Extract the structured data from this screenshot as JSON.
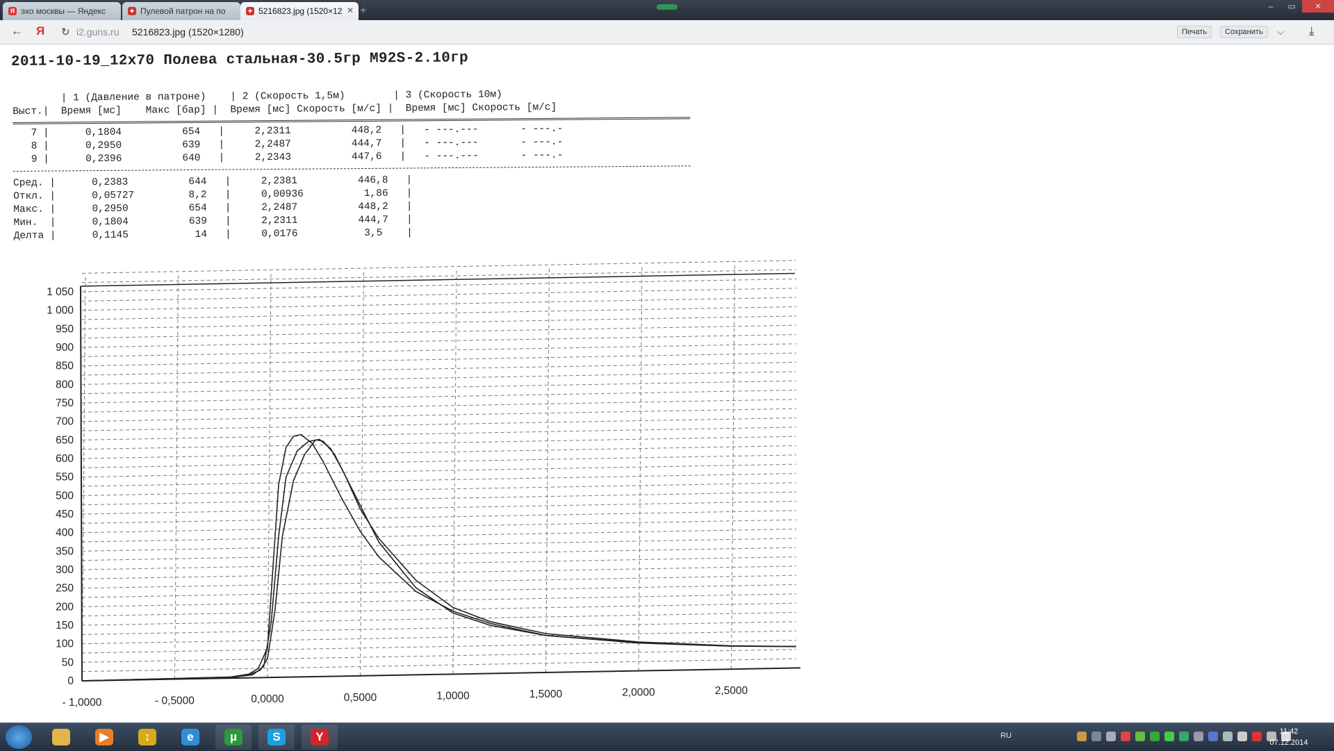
{
  "tabs": [
    {
      "label": "эхо москвы — Яндекс",
      "icon_color": "#d33"
    },
    {
      "label": "Пулевой патрон на по",
      "icon_color": "#c33"
    },
    {
      "label": "5216823.jpg (1520×12",
      "icon_color": "#c33"
    }
  ],
  "window": {
    "minimize": "–",
    "maximize": "▭",
    "close": "✕"
  },
  "address": {
    "host": "i2.guns.ru",
    "title": "5216823.jpg (1520×1280)"
  },
  "toolbar": {
    "print": "Печать",
    "save": "Сохранить"
  },
  "doc_title": "2011-10-19_12x70 Полева стальная-30.5гр M92S-2.10гр",
  "table": {
    "header1": "        | 1 (Давление в патроне)    | 2 (Скорость 1,5м)        | 3 (Скорость 10м)",
    "header2": "Выст.|  Время [мс]    Макс [бар] |  Время [мс] Скорость [м/с] |  Время [мс] Скорость [м/с]",
    "rows": [
      "   7 |      0,1804          654   |     2,2311          448,2   |   - ---.---       - ---.-",
      "   8 |      0,2950          639   |     2,2487          444,7   |   - ---.---       - ---.-",
      "   9 |      0,2396          640   |     2,2343          447,6   |   - ---.---       - ---.-"
    ],
    "stats": [
      "Сред. |      0,2383          644   |     2,2381          446,8   |",
      "Откл. |      0,05727         8,2   |     0,00936          1,86   |",
      "Макс. |      0,2950          654   |     2,2487          448,2   |",
      "Мин.  |      0,1804          639   |     2,2311          444,7   |",
      "Делта |      0,1145           14   |     0,0176           3,5    |"
    ]
  },
  "chart_data": {
    "type": "line",
    "x_ticks": [
      "- 1,0000",
      "- 0,5000",
      "0,0000",
      "0,5000",
      "1,0000",
      "1,5000",
      "2,0000",
      "2,5000"
    ],
    "y_ticks": [
      "0",
      "50",
      "100",
      "150",
      "200",
      "250",
      "300",
      "350",
      "400",
      "450",
      "500",
      "550",
      "600",
      "650",
      "700",
      "750",
      "800",
      "850",
      "900",
      "950",
      "1 000",
      "1 050"
    ],
    "xlim": [
      -1.0,
      2.85
    ],
    "ylim": [
      0,
      1050
    ],
    "grid": true,
    "series": [
      {
        "x": [
          -1.0,
          -0.2,
          -0.1,
          -0.05,
          0.0,
          0.03,
          0.06,
          0.1,
          0.14,
          0.18,
          0.24,
          0.3,
          0.4,
          0.5,
          0.6,
          0.8,
          1.0,
          1.2,
          1.5,
          2.0,
          2.5,
          2.85
        ],
        "y": [
          0,
          3,
          10,
          25,
          80,
          300,
          520,
          620,
          650,
          654,
          630,
          580,
          480,
          390,
          320,
          225,
          170,
          135,
          100,
          75,
          62,
          58
        ]
      },
      {
        "x": [
          -1.0,
          -0.2,
          -0.1,
          -0.04,
          0.0,
          0.04,
          0.08,
          0.14,
          0.2,
          0.26,
          0.3,
          0.36,
          0.42,
          0.5,
          0.6,
          0.8,
          1.0,
          1.2,
          1.5,
          2.0,
          2.5,
          2.85
        ],
        "y": [
          0,
          3,
          8,
          20,
          50,
          180,
          380,
          530,
          600,
          639,
          635,
          600,
          540,
          450,
          370,
          255,
          180,
          140,
          105,
          78,
          63,
          58
        ]
      },
      {
        "x": [
          -1.0,
          -0.2,
          -0.08,
          -0.02,
          0.02,
          0.06,
          0.1,
          0.16,
          0.22,
          0.28,
          0.34,
          0.4,
          0.5,
          0.6,
          0.8,
          1.0,
          1.2,
          1.5,
          2.0,
          2.5,
          2.85
        ],
        "y": [
          0,
          2,
          8,
          30,
          150,
          380,
          540,
          610,
          635,
          640,
          615,
          560,
          460,
          360,
          235,
          165,
          130,
          100,
          76,
          62,
          58
        ]
      }
    ]
  },
  "taskbar": {
    "items": [
      {
        "glyph": "",
        "color": "#e2b54a"
      },
      {
        "glyph": "▶",
        "color": "#e97d2a"
      },
      {
        "glyph": "↕",
        "color": "#d7a91c"
      },
      {
        "glyph": "e",
        "color": "#2f8fd6"
      },
      {
        "glyph": "µ",
        "color": "#2b9a3a"
      },
      {
        "glyph": "S",
        "color": "#1da0e0"
      },
      {
        "glyph": "Y",
        "color": "#d0262a"
      }
    ],
    "lang": "RU",
    "time": "11:42",
    "date": "07.12.2014"
  }
}
